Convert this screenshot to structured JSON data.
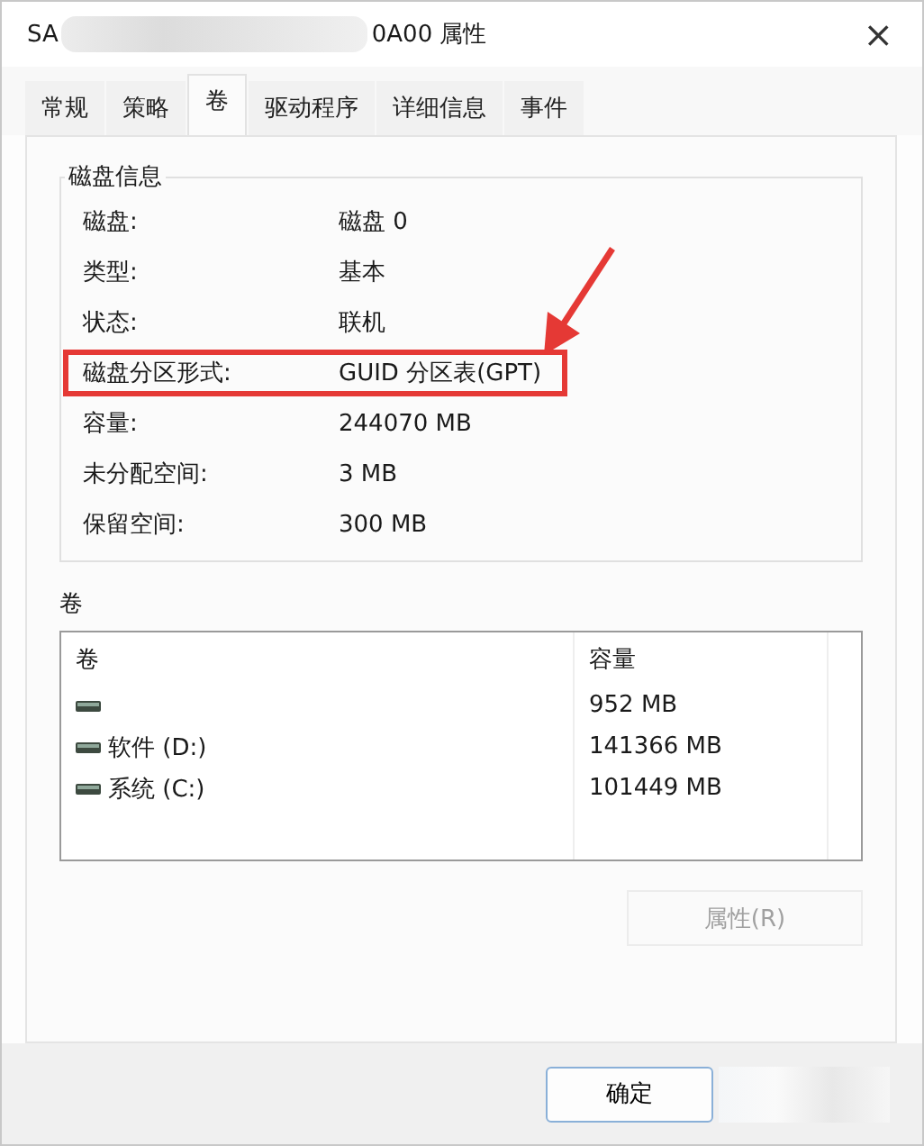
{
  "window": {
    "title_start": "SA",
    "title_end": "0A00 属性",
    "close": "×"
  },
  "tabs": [
    {
      "label": "常规",
      "selected": false
    },
    {
      "label": "策略",
      "selected": false
    },
    {
      "label": "卷",
      "selected": true
    },
    {
      "label": "驱动程序",
      "selected": false
    },
    {
      "label": "详细信息",
      "selected": false
    },
    {
      "label": "事件",
      "selected": false
    }
  ],
  "disk_info": {
    "title": "磁盘信息",
    "rows": [
      {
        "label": "磁盘:",
        "value": "磁盘 0",
        "highlighted": false
      },
      {
        "label": "类型:",
        "value": "基本",
        "highlighted": false
      },
      {
        "label": "状态:",
        "value": "联机",
        "highlighted": false
      },
      {
        "label": "磁盘分区形式:",
        "value": "GUID 分区表(GPT)",
        "highlighted": true
      },
      {
        "label": "容量:",
        "value": "244070 MB",
        "highlighted": false
      },
      {
        "label": "未分配空间:",
        "value": "3 MB",
        "highlighted": false
      },
      {
        "label": "保留空间:",
        "value": "300 MB",
        "highlighted": false
      }
    ]
  },
  "volumes": {
    "title": "卷",
    "columns": [
      "卷",
      "容量"
    ],
    "rows": [
      {
        "capacity": "952 MB"
      },
      {
        "name": "软件 (D:)",
        "capacity": "141366 MB"
      },
      {
        "name": "系统 (C:)",
        "capacity": "101449 MB"
      }
    ]
  },
  "properties_button": {
    "label": "属性(R)",
    "disabled": true
  },
  "ok_button": {
    "label": "确定"
  }
}
